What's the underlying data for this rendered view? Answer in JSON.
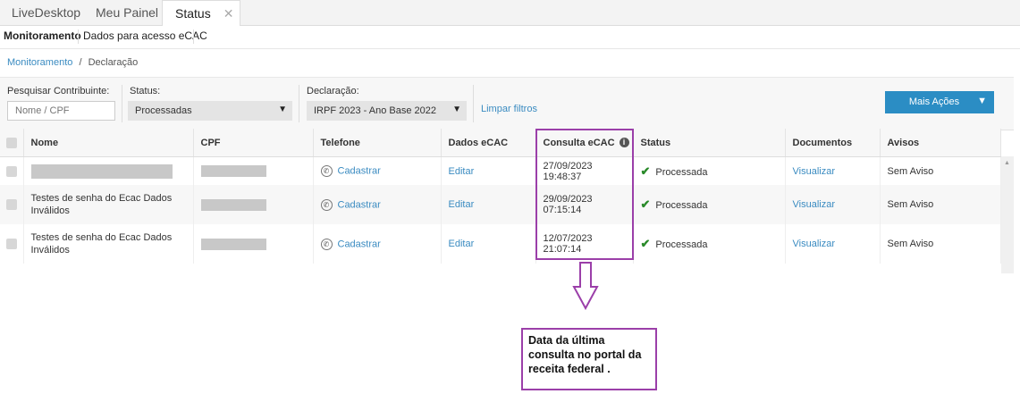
{
  "tabs": [
    {
      "label": "LiveDesktop"
    },
    {
      "label": "Meu Painel"
    },
    {
      "label": "Status",
      "close": "✕"
    }
  ],
  "subtabs": [
    {
      "label": "Monitoramento"
    },
    {
      "label": "Dados para acesso eCAC"
    }
  ],
  "breadcrumb": {
    "link": "Monitoramento",
    "sep": "/",
    "current": "Declaração"
  },
  "filters": {
    "contribuinte_label": "Pesquisar Contribuinte:",
    "contribuinte_placeholder": "Nome / CPF",
    "status_label": "Status:",
    "status_value": "Processadas",
    "declaracao_label": "Declaração:",
    "declaracao_value": "IRPF 2023 - Ano Base 2022",
    "clear_label": "Limpar filtros",
    "actions_label": "Mais Ações"
  },
  "columns": [
    "Nome",
    "CPF",
    "Telefone",
    "Dados eCAC",
    "Consulta eCAC",
    "Status",
    "Documentos",
    "Avisos"
  ],
  "rows": [
    {
      "nome": "",
      "telefone": "Cadastrar",
      "dados": "Editar",
      "consulta": "27/09/2023 19:48:37",
      "status": "Processada",
      "documentos": "Visualizar",
      "avisos": "Sem Aviso"
    },
    {
      "nome": "Testes de senha do Ecac Dados Inválidos",
      "telefone": "Cadastrar",
      "dados": "Editar",
      "consulta": "29/09/2023 07:15:14",
      "status": "Processada",
      "documentos": "Visualizar",
      "avisos": "Sem Aviso"
    },
    {
      "nome": "Testes de senha do Ecac Dados Inválidos",
      "telefone": "Cadastrar",
      "dados": "Editar",
      "consulta": "12/07/2023 21:07:14",
      "status": "Processada",
      "documentos": "Visualizar",
      "avisos": "Sem Aviso"
    }
  ],
  "annotation": {
    "text": "Data da última consulta no portal da receita federal .",
    "color": "#9b3fa9"
  },
  "colors": {
    "accent": "#2b8dc4",
    "link": "#3a8bc1",
    "success": "#2a8a2a"
  }
}
